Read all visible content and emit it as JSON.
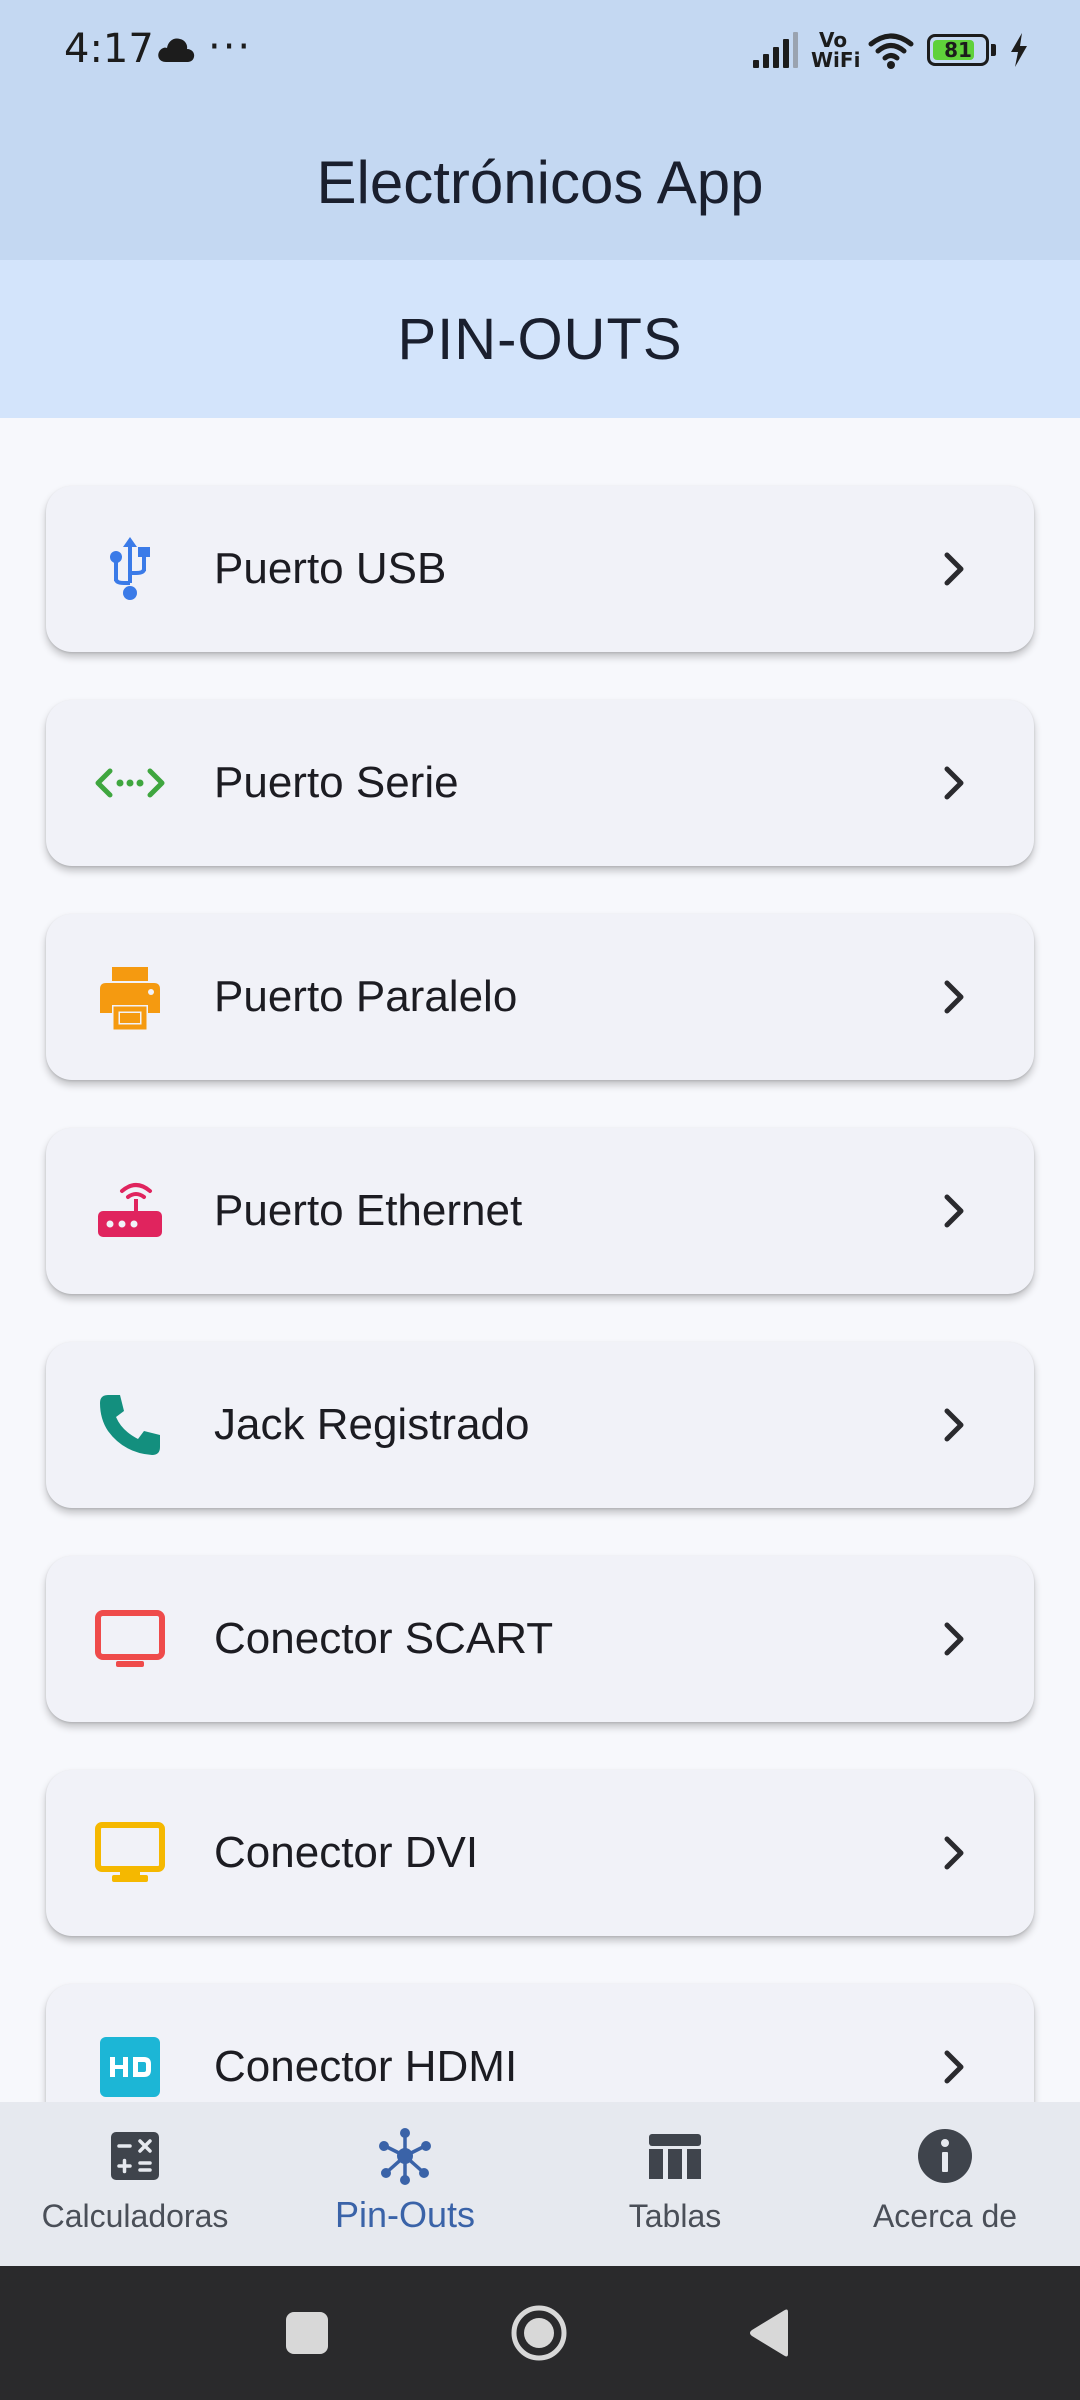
{
  "status": {
    "time": "4:17",
    "dots": "···",
    "vowifi_top": "Vo",
    "vowifi_bottom": "WiFi",
    "battery_level": "81",
    "battery_fraction": 0.81
  },
  "app": {
    "title": "Electrónicos App",
    "section_title": "PIN-OUTS"
  },
  "list": {
    "items": [
      {
        "label": "Puerto USB",
        "icon": "usb-icon",
        "color": "#3b7be8"
      },
      {
        "label": "Puerto Serie",
        "icon": "serial-code-icon",
        "color": "#3fa63f"
      },
      {
        "label": "Puerto Paralelo",
        "icon": "printer-icon",
        "color": "#f59a10"
      },
      {
        "label": "Puerto Ethernet",
        "icon": "router-icon",
        "color": "#e0245e"
      },
      {
        "label": "Jack Registrado",
        "icon": "phone-icon",
        "color": "#138f7e"
      },
      {
        "label": "Conector SCART",
        "icon": "tv-icon",
        "color": "#ef4b4b"
      },
      {
        "label": "Conector DVI",
        "icon": "monitor-icon",
        "color": "#f5b800"
      },
      {
        "label": "Conector HDMI",
        "icon": "hd-icon",
        "color": "#1cb6d6"
      }
    ]
  },
  "nav": {
    "items": [
      {
        "label": "Calculadoras",
        "icon": "calculator-icon"
      },
      {
        "label": "Pin-Outs",
        "icon": "hub-icon",
        "active": true
      },
      {
        "label": "Tablas",
        "icon": "table-icon"
      },
      {
        "label": "Acerca de",
        "icon": "info-icon"
      }
    ]
  },
  "colors": {
    "appbar": "#c4d8f2",
    "section_header": "#d3e4fb",
    "nav_active": "#3a63a8",
    "nav_inactive": "#4a4f58"
  }
}
